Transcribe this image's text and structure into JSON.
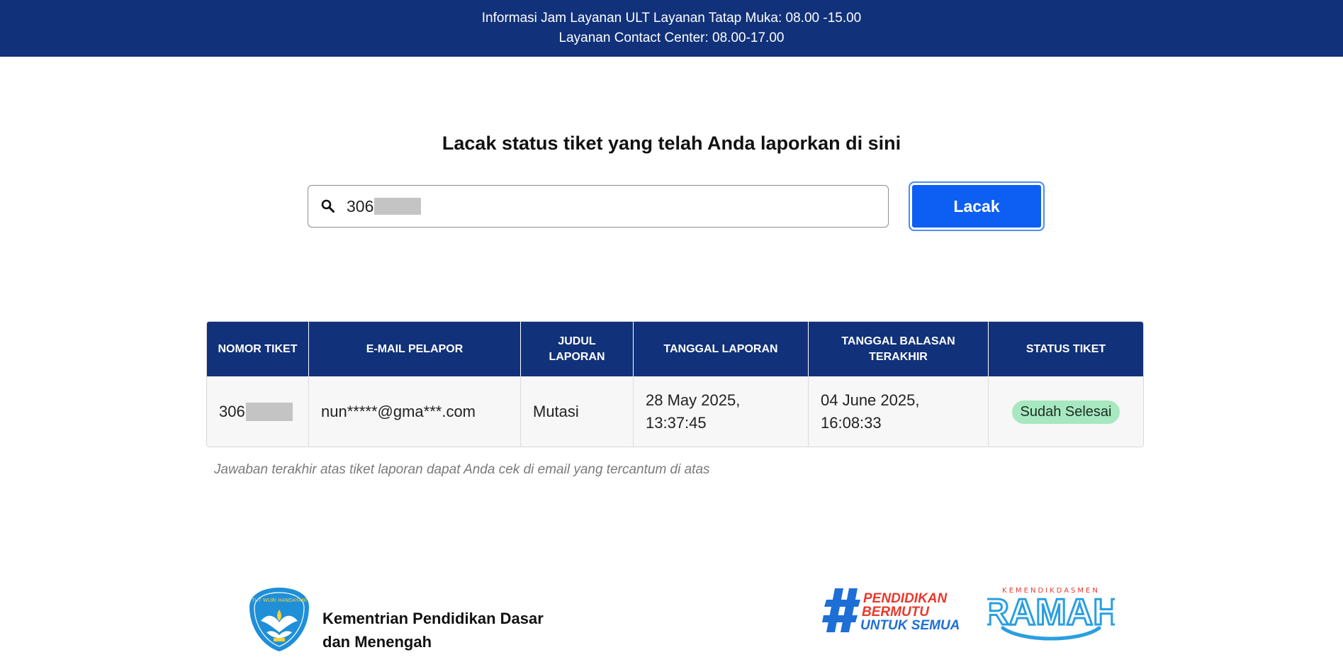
{
  "banner": {
    "line1": "Informasi Jam Layanan ULT Layanan Tatap Muka: 08.00 -15.00",
    "line2": "Layanan Contact Center: 08.00-17.00"
  },
  "search": {
    "heading": "Lacak status tiket yang telah Anda laporkan di sini",
    "value_prefix": "306",
    "button_label": "Lacak",
    "icon": "search-icon"
  },
  "table": {
    "columns": [
      "NOMOR TIKET",
      "E-MAIL PELAPOR",
      "JUDUL LAPORAN",
      "TANGGAL LAPORAN",
      "TANGGAL BALASAN TERAKHIR",
      "STATUS TIKET"
    ],
    "rows": [
      {
        "ticket_prefix": "306",
        "email": "nun*****@gma***.com",
        "title": "Mutasi",
        "report_date": "28 May 2025, 13:37:45",
        "last_reply": "04 June 2025, 16:08:33",
        "status": "Sudah Selesai"
      }
    ],
    "note": "Jawaban terakhir atas tiket laporan dapat Anda cek di email yang tercantum di atas"
  },
  "footer": {
    "org_line1": "Kementrian Pendidikan Dasar",
    "org_line2": "dan Menengah",
    "emblem_text": "TUT WURI HANDAYANI",
    "hashtag_line1": "PENDIDIKAN",
    "hashtag_line2": "BERMUTU",
    "hashtag_line3": "UNTUK SEMUA",
    "ramah_top": "KEMENDIKDASMEN",
    "ramah_word": "RAMAH"
  },
  "colors": {
    "navy": "#11317a",
    "button_blue": "#0d5ef2",
    "badge_green": "#a7e8c0",
    "hashtag_red": "#e8392b",
    "hashtag_blue": "#1d6fd6",
    "ramah_blue": "#2a9fe0"
  }
}
